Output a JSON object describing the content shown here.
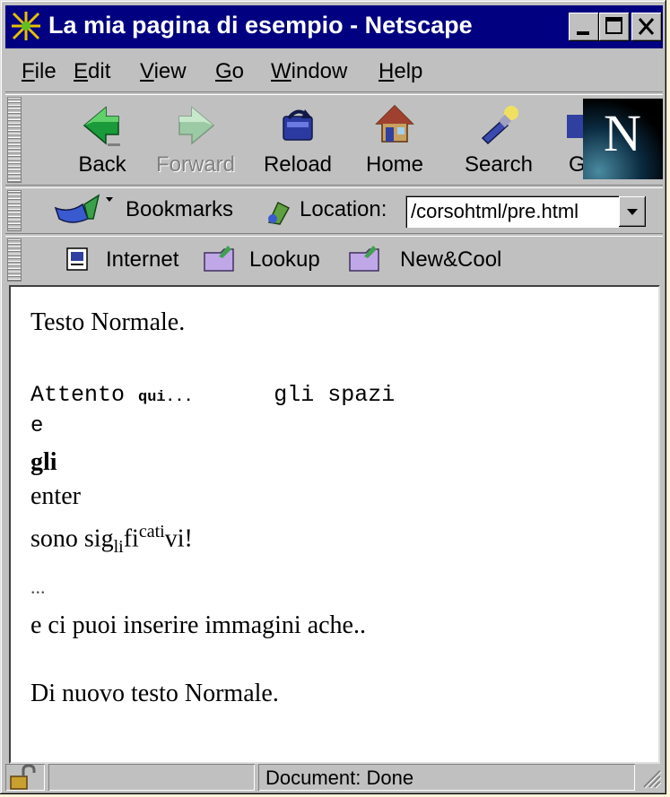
{
  "window": {
    "title": "La mia pagina di esempio - Netscape"
  },
  "menu": [
    {
      "label": "File",
      "accel": "F"
    },
    {
      "label": "Edit",
      "accel": "E"
    },
    {
      "label": "View",
      "accel": "V"
    },
    {
      "label": "Go",
      "accel": "G"
    },
    {
      "label": "Window",
      "accel": "W"
    },
    {
      "label": "Help",
      "accel": "H"
    }
  ],
  "nav_toolbar": {
    "back": "Back",
    "forward": "Forward",
    "reload": "Reload",
    "home": "Home",
    "search": "Search",
    "guide_partial": "G"
  },
  "location_toolbar": {
    "bookmarks": "Bookmarks",
    "location_label": "Location:",
    "location_value": "/corsohtml/pre.html"
  },
  "personal_toolbar": {
    "internet": "Internet",
    "lookup": "Lookup",
    "newcool": "New&Cool"
  },
  "document": {
    "line1": "Testo Normale.",
    "pre_part1": "Attento ",
    "pre_small": "qui...",
    "pre_part2": "      gli spazi",
    "e": "e",
    "gli": "gli",
    "enter": "enter",
    "sono_prefix": "sono sig",
    "sub_text": "li",
    "fi": "fi",
    "sup_text": "cati",
    "sono_suffix": "vi!",
    "ellipsis": "...",
    "images_line": "e ci puoi inserire immagini ache..",
    "last_line": "Di nuovo testo Normale."
  },
  "status": {
    "text": "Document: Done"
  },
  "colors": {
    "titlebar": "#000080",
    "chrome": "#c0c0c0",
    "background": "#fbf6d8"
  }
}
